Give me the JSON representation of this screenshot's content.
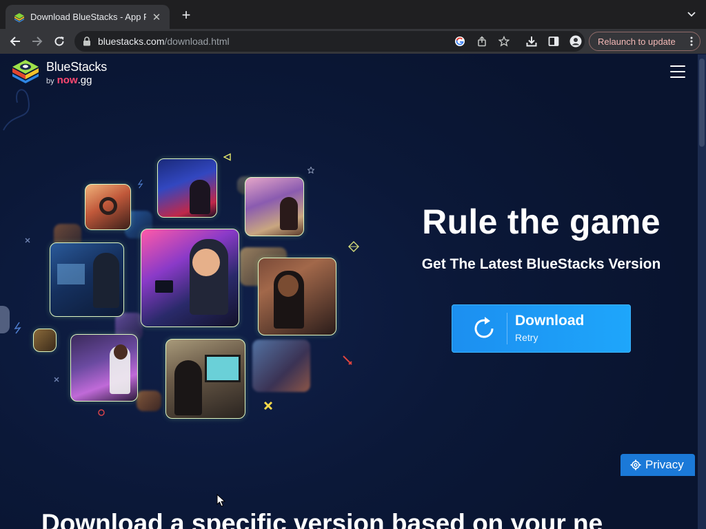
{
  "browser": {
    "tab_title": "Download BlueStacks - App Pl",
    "url_host": "bluestacks.com",
    "url_path": "/download.html",
    "relaunch_label": "Relaunch to update"
  },
  "header": {
    "logo_name": "BlueStacks",
    "logo_by": "by",
    "logo_now": "now",
    "logo_gg": ".gg"
  },
  "hero": {
    "title": "Rule the game",
    "subtitle": "Get The Latest BlueStacks Version",
    "download_label": "Download",
    "download_status": "Retry"
  },
  "section": {
    "heading": "Download a specific version based on your ne"
  },
  "privacy_label": "Privacy",
  "colors": {
    "page_bg": "#0b1535",
    "download_button": "#1ea0f6",
    "privacy_button": "#1b79d8",
    "tile_border": "#dff7c2",
    "brand_now": "#ff4770"
  }
}
